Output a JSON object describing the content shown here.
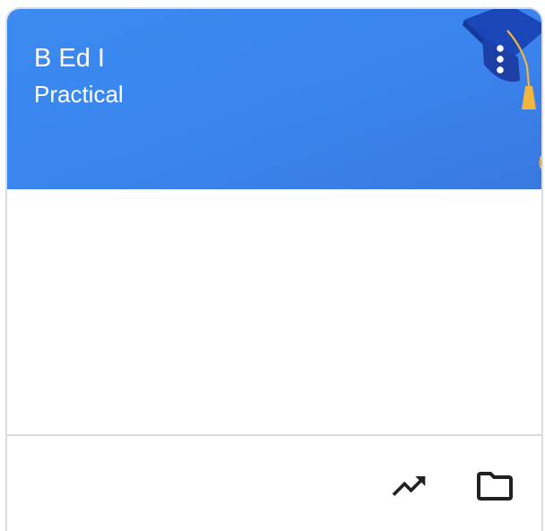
{
  "card": {
    "title": "B Ed I",
    "section": "Practical",
    "header_color": "#3a84ee",
    "more_icon": "more-vert-icon",
    "illustration": "graduation-cap-icon"
  },
  "footer": {
    "actions": [
      {
        "icon": "trending-up-icon"
      },
      {
        "icon": "folder-icon"
      }
    ]
  }
}
